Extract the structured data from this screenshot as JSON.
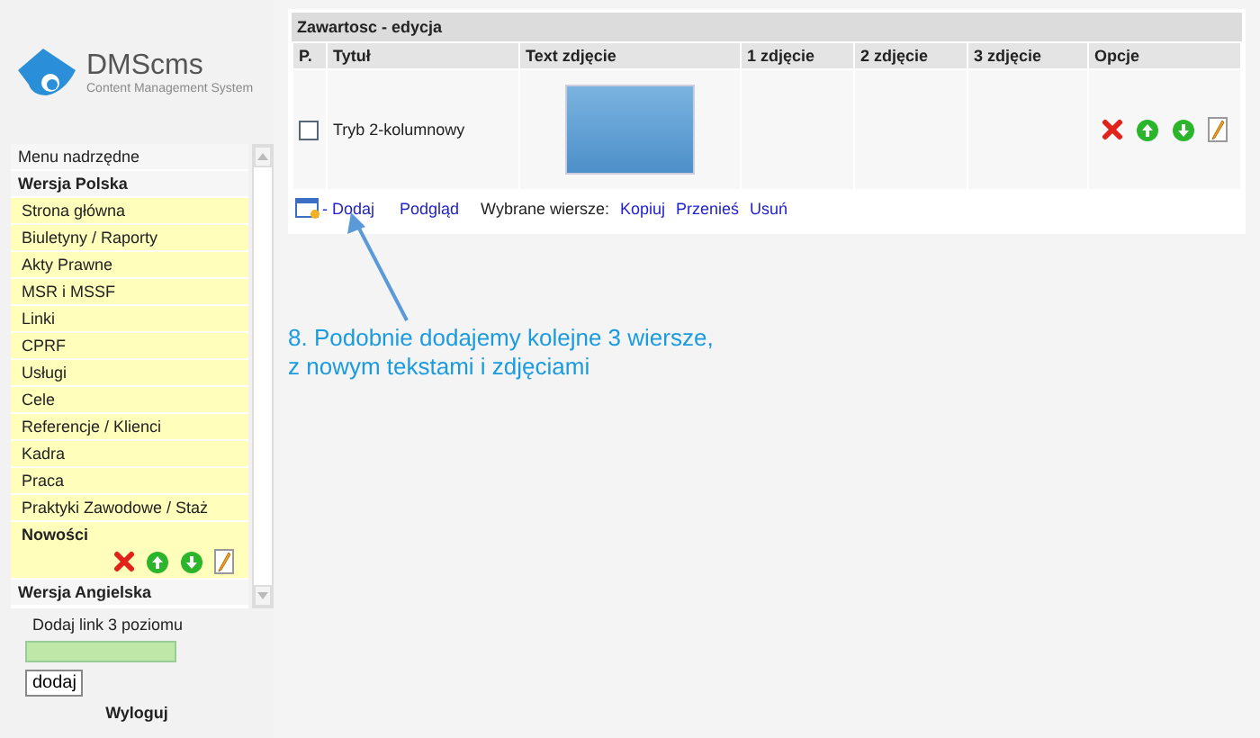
{
  "logo": {
    "name": "DMScms",
    "tagline": "Content Management System"
  },
  "sidebar": {
    "header": "Menu nadrzędne",
    "groups": [
      {
        "label": "Wersja Polska",
        "children": [
          {
            "label": "Strona główna",
            "selected": false
          },
          {
            "label": "Biuletyny / Raporty",
            "selected": false
          },
          {
            "label": "Akty Prawne",
            "selected": false
          },
          {
            "label": "MSR i MSSF",
            "selected": false
          },
          {
            "label": "Linki",
            "selected": false
          },
          {
            "label": "CPRF",
            "selected": false
          },
          {
            "label": "Usługi",
            "selected": false
          },
          {
            "label": "Cele",
            "selected": false
          },
          {
            "label": "Referencje / Klienci",
            "selected": false
          },
          {
            "label": "Kadra",
            "selected": false
          },
          {
            "label": "Praca",
            "selected": false
          },
          {
            "label": "Praktyki Zawodowe / Staż",
            "selected": false
          },
          {
            "label": "Nowości",
            "selected": true
          }
        ]
      },
      {
        "label": "Wersja Angielska"
      }
    ]
  },
  "add_link": {
    "label": "Dodaj link 3 poziomu",
    "button": "dodaj"
  },
  "logout": "Wyloguj",
  "content": {
    "title": "Zawartosc - edycja",
    "columns": [
      "P.",
      "Tytuł",
      "Text zdjęcie",
      "1 zdjęcie",
      "2 zdjęcie",
      "3 zdjęcie",
      "Opcje"
    ],
    "rows": [
      {
        "checked": false,
        "title": "Tryb 2-kolumnowy"
      }
    ],
    "footer": {
      "add": "- Dodaj",
      "preview": "Podgląd",
      "selected_label": "Wybrane wiersze:",
      "actions": [
        "Kopiuj",
        "Przenieś",
        "Usuń"
      ]
    }
  },
  "annotation": [
    "8. Podobnie dodajemy kolejne 3 wiersze,",
    "z nowym tekstami i zdjęciami"
  ]
}
